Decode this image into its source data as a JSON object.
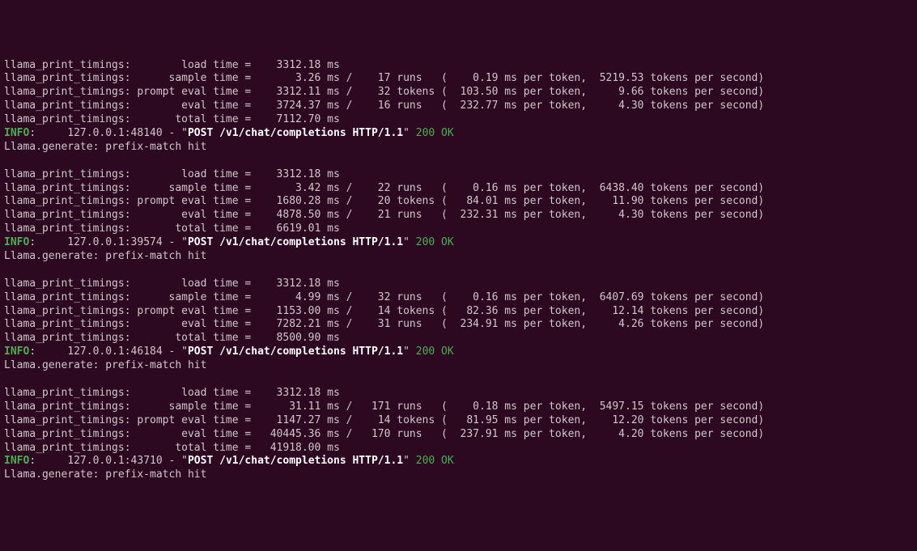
{
  "blocks": [
    {
      "port": "48140",
      "timings": [
        {
          "label": "llama_print_timings:        load time =    3312.18 ms"
        },
        {
          "label": "llama_print_timings:      sample time =       3.26 ms /    17 runs   (    0.19 ms per token,  5219.53 tokens per second)"
        },
        {
          "label": "llama_print_timings: prompt eval time =    3312.11 ms /    32 tokens (  103.50 ms per token,     9.66 tokens per second)"
        },
        {
          "label": "llama_print_timings:        eval time =    3724.37 ms /    16 runs   (  232.77 ms per token,     4.30 tokens per second)"
        },
        {
          "label": "llama_print_timings:       total time =    7112.70 ms"
        }
      ],
      "info_prefix": "INFO",
      "info_addr": ":     127.0.0.1:48140 - \"",
      "info_req": "POST /v1/chat/completions HTTP/1.1",
      "info_mid": "\" ",
      "info_status": "200 OK",
      "generate": "Llama.generate: prefix-match hit"
    },
    {
      "port": "39574",
      "timings": [
        {
          "label": "llama_print_timings:        load time =    3312.18 ms"
        },
        {
          "label": "llama_print_timings:      sample time =       3.42 ms /    22 runs   (    0.16 ms per token,  6438.40 tokens per second)"
        },
        {
          "label": "llama_print_timings: prompt eval time =    1680.28 ms /    20 tokens (   84.01 ms per token,    11.90 tokens per second)"
        },
        {
          "label": "llama_print_timings:        eval time =    4878.50 ms /    21 runs   (  232.31 ms per token,     4.30 tokens per second)"
        },
        {
          "label": "llama_print_timings:       total time =    6619.01 ms"
        }
      ],
      "info_prefix": "INFO",
      "info_addr": ":     127.0.0.1:39574 - \"",
      "info_req": "POST /v1/chat/completions HTTP/1.1",
      "info_mid": "\" ",
      "info_status": "200 OK",
      "generate": "Llama.generate: prefix-match hit"
    },
    {
      "port": "46184",
      "timings": [
        {
          "label": "llama_print_timings:        load time =    3312.18 ms"
        },
        {
          "label": "llama_print_timings:      sample time =       4.99 ms /    32 runs   (    0.16 ms per token,  6407.69 tokens per second)"
        },
        {
          "label": "llama_print_timings: prompt eval time =    1153.00 ms /    14 tokens (   82.36 ms per token,    12.14 tokens per second)"
        },
        {
          "label": "llama_print_timings:        eval time =    7282.21 ms /    31 runs   (  234.91 ms per token,     4.26 tokens per second)"
        },
        {
          "label": "llama_print_timings:       total time =    8500.90 ms"
        }
      ],
      "info_prefix": "INFO",
      "info_addr": ":     127.0.0.1:46184 - \"",
      "info_req": "POST /v1/chat/completions HTTP/1.1",
      "info_mid": "\" ",
      "info_status": "200 OK",
      "generate": "Llama.generate: prefix-match hit"
    },
    {
      "port": "43710",
      "timings": [
        {
          "label": "llama_print_timings:        load time =    3312.18 ms"
        },
        {
          "label": "llama_print_timings:      sample time =      31.11 ms /   171 runs   (    0.18 ms per token,  5497.15 tokens per second)"
        },
        {
          "label": "llama_print_timings: prompt eval time =    1147.27 ms /    14 tokens (   81.95 ms per token,    12.20 tokens per second)"
        },
        {
          "label": "llama_print_timings:        eval time =   40445.36 ms /   170 runs   (  237.91 ms per token,     4.20 tokens per second)"
        },
        {
          "label": "llama_print_timings:       total time =   41918.00 ms"
        }
      ],
      "info_prefix": "INFO",
      "info_addr": ":     127.0.0.1:43710 - \"",
      "info_req": "POST /v1/chat/completions HTTP/1.1",
      "info_mid": "\" ",
      "info_status": "200 OK",
      "generate": "Llama.generate: prefix-match hit"
    }
  ],
  "blank": ""
}
